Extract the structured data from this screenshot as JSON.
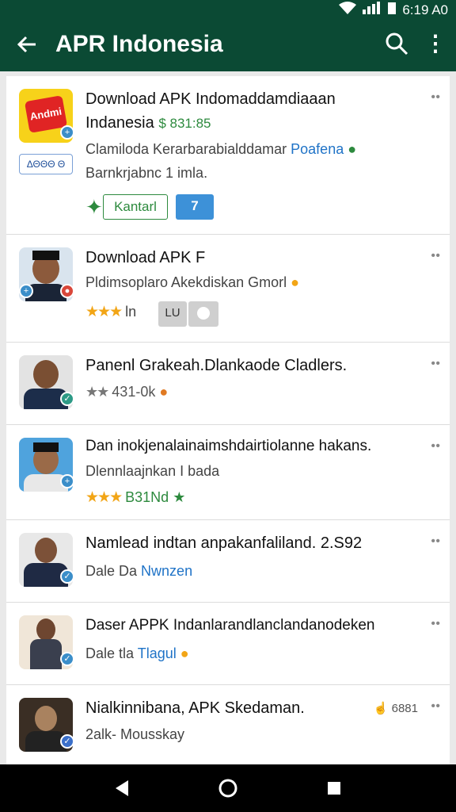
{
  "status_bar": {
    "time": "6:19 A0"
  },
  "app_bar": {
    "title": "APR Indonesia"
  },
  "items": [
    {
      "title_line1": "Download APK Indomaddamdiaaan",
      "title_line2": "Indanesia",
      "count": "$ 831:85",
      "desc_line1": "Clamiloda Kerarbarabialddamar",
      "desc_link": "Poafena",
      "desc_line2": "Barnkrjabnc 1 imla.",
      "tag": "ΔΘΘΘ Θ",
      "button_label": "Kantarl",
      "button2_label": "7",
      "icon_text": "Andmi"
    },
    {
      "title": "Download APK F",
      "desc": "Pldimsoplaro Akekdiskan Gmorl",
      "rating_text": "ln",
      "chip_text": "LU"
    },
    {
      "title": "Panenl Grakeah.Dlankaode Cladlers.",
      "rating_text": "431-0k"
    },
    {
      "title": "Dan inokjenalainaimshdairtiolanne hakans.",
      "desc": "Dlennlaajnkan I bada",
      "rating_text": "B31Nd"
    },
    {
      "title": "Namlead indtan anpakanfaliland. 2.S92",
      "desc_prefix": "Dale Da",
      "desc_link": "Nwnzen"
    },
    {
      "title": "Daser APPK Indanlarandlanclandanodeken",
      "desc_prefix": "Dale tla",
      "desc_link": "Tlagul"
    },
    {
      "title": "Nialkinnibana, APK Skedaman.",
      "desc": "2alk- Mousskay",
      "count": "6881"
    }
  ],
  "colors": {
    "app_bar": "#0b4a34",
    "accent_green": "#2d8a3e",
    "link_blue": "#1f73c7",
    "star": "#f2a516"
  }
}
